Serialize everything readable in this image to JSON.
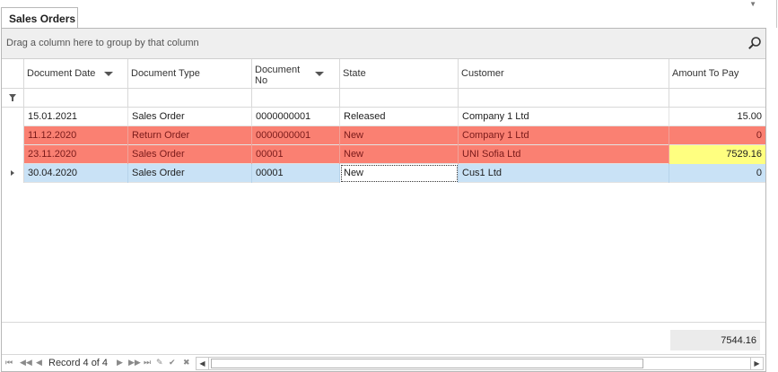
{
  "tab": {
    "label": "Sales Orders"
  },
  "group_bar": {
    "hint": "Drag a column here to group by that column"
  },
  "columns": [
    {
      "label": "Document Date"
    },
    {
      "label": "Document Type"
    },
    {
      "label": "Document No"
    },
    {
      "label": "State"
    },
    {
      "label": "Customer"
    },
    {
      "label": "Amount To Pay"
    }
  ],
  "rows": [
    {
      "date": "15.01.2021",
      "type": "Sales Order",
      "no": "0000000001",
      "state": "Released",
      "customer": "Company 1 Ltd",
      "amount": "15.00"
    },
    {
      "date": "11.12.2020",
      "type": "Return Order",
      "no": "0000000001",
      "state": "New",
      "customer": "Company 1 Ltd",
      "amount": "0"
    },
    {
      "date": "23.11.2020",
      "type": "Sales Order",
      "no": "00001",
      "state": "New",
      "customer": "UNI Sofia Ltd",
      "amount": "7529.16"
    },
    {
      "date": "30.04.2020",
      "type": "Sales Order",
      "no": "00001",
      "state": "New",
      "customer": "Cus1 Ltd",
      "amount": "0"
    }
  ],
  "footer": {
    "total": "7544.16"
  },
  "navigator": {
    "record_text": "Record 4 of 4"
  },
  "colors": {
    "error_row": "#fa8072",
    "selected_row": "#c9e2f6",
    "highlight_cell": "#ffff80"
  }
}
